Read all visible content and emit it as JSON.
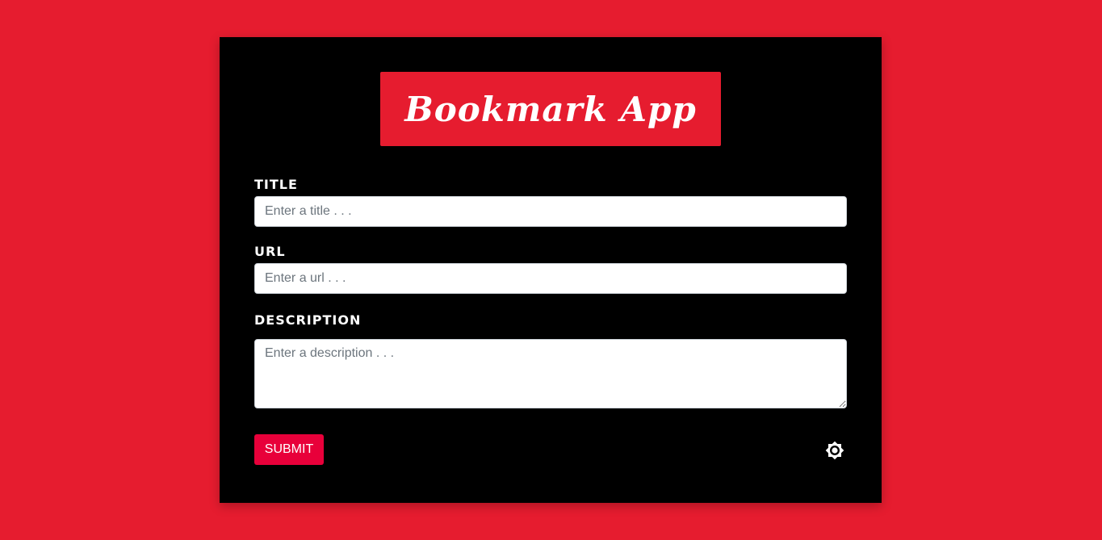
{
  "header": {
    "title": "Bookmark App"
  },
  "form": {
    "title_label": "TITLE",
    "title_placeholder": "Enter a title . . .",
    "url_label": "URL",
    "url_placeholder": "Enter a url . . .",
    "description_label": "DESCRIPTION",
    "description_placeholder": "Enter a description . . .",
    "submit_label": "SUBMIT"
  },
  "icons": {
    "theme_toggle": "brightness-icon"
  },
  "colors": {
    "background": "#e61c2f",
    "card": "#000000",
    "accent": "#e8003a",
    "text": "#ffffff"
  }
}
